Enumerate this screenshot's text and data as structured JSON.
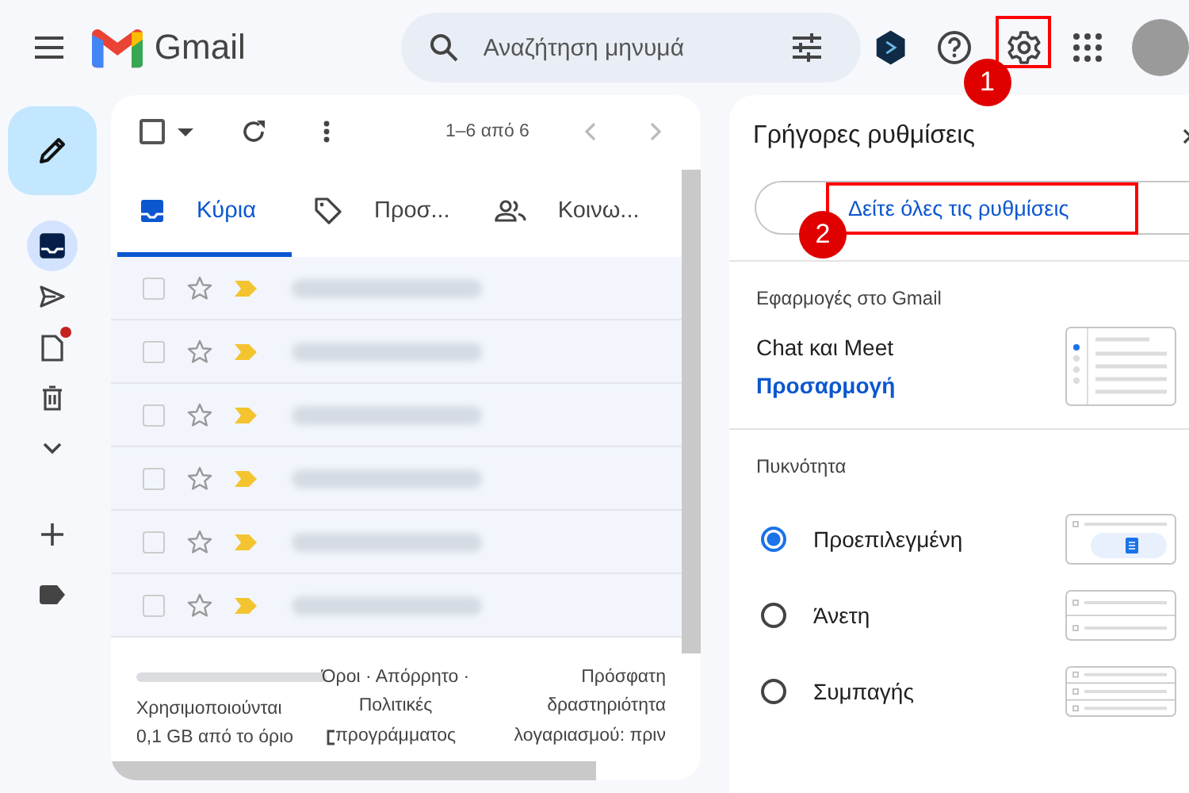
{
  "topbar": {
    "brand": "Gmail",
    "search": {
      "placeholder": "Αναζήτηση μηνυμά"
    }
  },
  "sidebar": {
    "items": [
      {
        "kind": "inbox",
        "selected": true,
        "notification": false
      },
      {
        "kind": "sent",
        "selected": false,
        "notification": false
      },
      {
        "kind": "drafts",
        "selected": false,
        "notification": true
      },
      {
        "kind": "trash",
        "selected": false,
        "notification": false
      },
      {
        "kind": "more",
        "selected": false,
        "notification": false
      },
      {
        "kind": "add",
        "selected": false,
        "notification": false
      },
      {
        "kind": "label",
        "selected": false,
        "notification": false
      }
    ]
  },
  "mail": {
    "select_all": {
      "checked": false
    },
    "range": "1–6 από 6",
    "tabs": [
      {
        "kind": "primary",
        "label": "Κύρια",
        "selected": true
      },
      {
        "kind": "promotions",
        "label": "Προσ...",
        "selected": false
      },
      {
        "kind": "social",
        "label": "Κοινω...",
        "selected": false
      }
    ],
    "rows": [
      {
        "checked": false,
        "starred": false,
        "important": true
      },
      {
        "checked": false,
        "starred": false,
        "important": true
      },
      {
        "checked": false,
        "starred": false,
        "important": true
      },
      {
        "checked": false,
        "starred": false,
        "important": true
      },
      {
        "checked": false,
        "starred": false,
        "important": true
      },
      {
        "checked": false,
        "starred": false,
        "important": true
      }
    ],
    "footer": {
      "storage": "Χρησιμοποιούνται 0,1 GB από το όριο",
      "links": "Όροι · Απόρρητο · Πολιτικές προγράμματος",
      "activity": "Πρόσφατη δραστηριότητα λογαριασμού: πριν"
    }
  },
  "quick_settings": {
    "title": "Γρήγορες ρυθμίσεις",
    "all_settings": "Δείτε όλες τις ρυθμίσεις",
    "apps": {
      "heading": "Εφαρμογές στο Gmail",
      "name": "Chat και Meet",
      "link": "Προσαρμογή"
    },
    "density": {
      "heading": "Πυκνότητα",
      "options": [
        {
          "kind": "default",
          "label": "Προεπιλεγμένη",
          "selected": true
        },
        {
          "kind": "comfortable",
          "label": "Άνετη",
          "selected": false
        },
        {
          "kind": "compact",
          "label": "Συμπαγής",
          "selected": false
        }
      ]
    }
  },
  "annotations": [
    {
      "label": "1"
    },
    {
      "label": "2"
    }
  ]
}
